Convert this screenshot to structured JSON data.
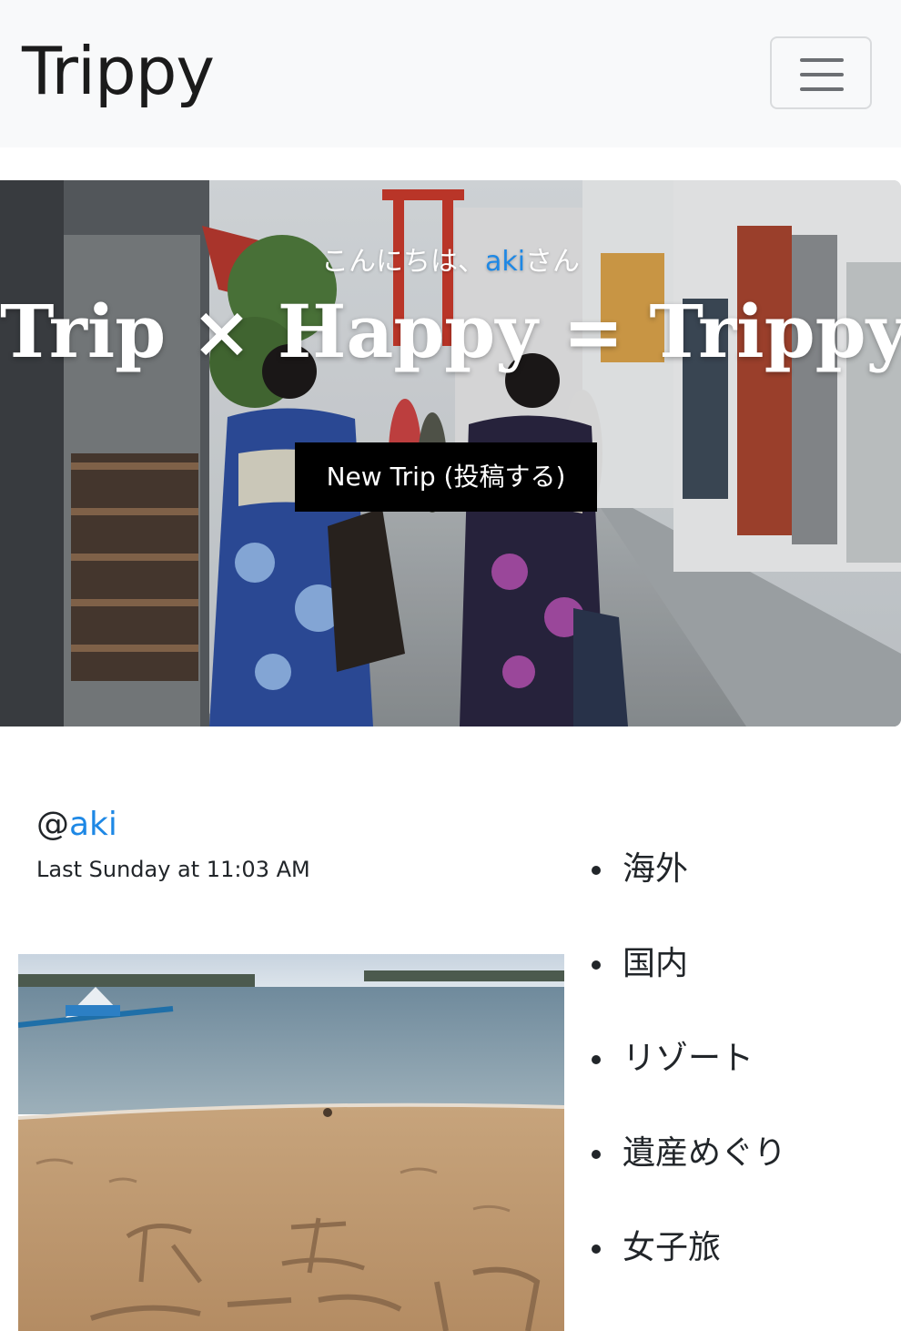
{
  "navbar": {
    "brand": "Trippy",
    "toggler_icon": "hamburger-menu-icon"
  },
  "hero": {
    "greeting_prefix": "こんにちは、",
    "greeting_user": "aki",
    "greeting_suffix": "さん",
    "tagline": "Trip × Happy = Trippy",
    "new_trip_label": "New Trip (投稿する)"
  },
  "post": {
    "user_at": "@",
    "user_name": "aki",
    "timestamp": "Last Sunday at 11:03 AM"
  },
  "categories": [
    "海外",
    "国内",
    "リゾート",
    "遺産めぐり",
    "女子旅"
  ],
  "colors": {
    "navbar_bg": "#f8f9fa",
    "link": "#1e88e5",
    "button_bg": "#000000",
    "text": "#212529"
  }
}
